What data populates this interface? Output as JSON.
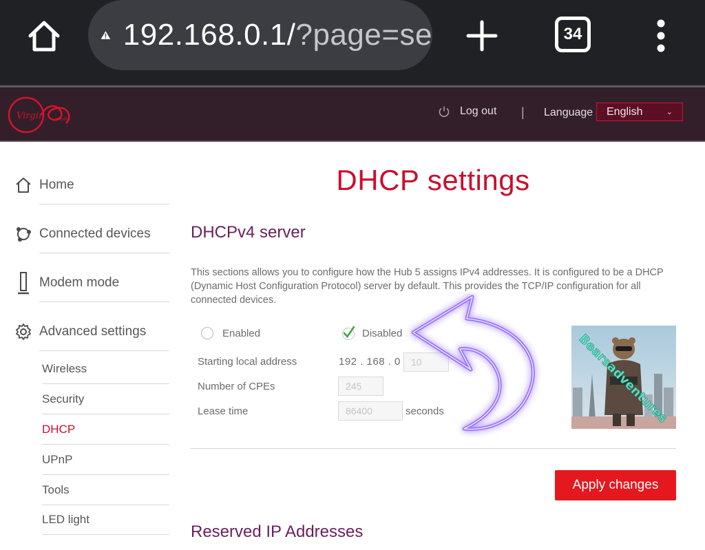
{
  "browser": {
    "url_host": "192.168.0.1/",
    "url_rest": "?page=se",
    "tab_count": "34"
  },
  "header": {
    "logo_alt": "Virgin media",
    "logout": "Log out",
    "separator": "|",
    "language_label": "Language",
    "language_value": "English"
  },
  "sidebar": {
    "items": [
      {
        "label": "Home",
        "icon": "house-icon"
      },
      {
        "label": "Connected devices",
        "icon": "network-icon"
      },
      {
        "label": "Modem mode",
        "icon": "modem-icon"
      },
      {
        "label": "Advanced settings",
        "icon": "gear-icon"
      }
    ],
    "subitems": [
      {
        "label": "Wireless"
      },
      {
        "label": "Security"
      },
      {
        "label": "DHCP",
        "active": true
      },
      {
        "label": "UPnP"
      },
      {
        "label": "Tools"
      },
      {
        "label": "LED light"
      }
    ]
  },
  "main": {
    "page_title": "DHCP settings",
    "section_title": "DHCPv4 server",
    "description": "This sections allows you to configure how the Hub 5 assigns IPv4 addresses. It is configured to be a DHCP (Dynamic Host Configuration Protocol) server by default. This provides the TCP/IP configuration for all connected devices.",
    "radio_enabled": "Enabled",
    "radio_disabled": "Disabled",
    "selected": "Disabled",
    "starting_local_address_label": "Starting local address",
    "ip_prefix": "192 . 168 . 0 .",
    "ip_last_octet": "10",
    "cpes_label": "Number of CPEs",
    "cpes_value": "245",
    "lease_label": "Lease time",
    "lease_value": "86400",
    "lease_unit": "seconds",
    "watermark": "Bearsadventures",
    "apply_button": "Apply changes",
    "reserved_title": "Reserved IP Addresses"
  },
  "colors": {
    "brand_red": "#c8102e",
    "section_purple": "#6a1f5c",
    "header_bg": "#321f2a",
    "chrome_bg": "#202124",
    "arrow_glow": "#7b4dff"
  }
}
